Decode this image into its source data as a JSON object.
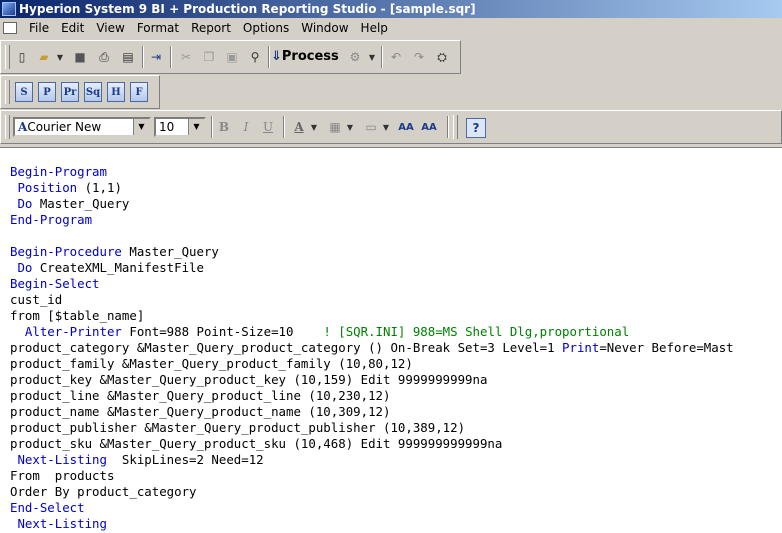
{
  "window": {
    "title": "Hyperion System 9 BI + Production Reporting Studio - [sample.sqr]"
  },
  "menu": [
    "File",
    "Edit",
    "View",
    "Format",
    "Report",
    "Options",
    "Window",
    "Help"
  ],
  "toolbar_main": {
    "icons": [
      "new-file-icon",
      "open-folder-icon",
      "dropdown-arrow-icon",
      "save-icon",
      "print-icon",
      "print-preview-icon",
      "export-icon",
      "cut-icon",
      "copy-icon",
      "paste-icon",
      "find-icon"
    ],
    "process_label": "Process"
  },
  "toolbar_sections": [
    "S",
    "P",
    "Pr",
    "Sq",
    "H",
    "F"
  ],
  "format": {
    "font": "Courier New",
    "size": "10"
  },
  "code": {
    "l1": "Begin-Program",
    "l2_kw": " Position",
    "l2_rest": " (1,1)",
    "l3_kw": " Do",
    "l3_rest": " Master_Query",
    "l4": "End-Program",
    "l6_kw": "Begin-Procedure",
    "l6_rest": " Master_Query",
    "l7_kw": " Do",
    "l7_rest": " CreateXML_ManifestFile",
    "l8": "Begin-Select",
    "l9": "cust_id",
    "l10": "from [$table_name]",
    "l11_kw": "  Alter-Printer",
    "l11_rest": " Font=988 Point-Size=10    ",
    "l11_cmt": "! [SQR.INI] 988=MS Shell Dlg,proportional",
    "l12_pre": "product_category &Master_Query_product_category () On-Break Set=3 Level=1 ",
    "l12_kw": "Print",
    "l12_post": "=Never Before=Mast",
    "l13": "product_family &Master_Query_product_family (10,80,12)",
    "l14": "product_key &Master_Query_product_key (10,159) Edit 9999999999na",
    "l15": "product_line &Master_Query_product_line (10,230,12)",
    "l16": "product_name &Master_Query_product_name (10,309,12)",
    "l17": "product_publisher &Master_Query_product_publisher (10,389,12)",
    "l18": "product_sku &Master_Query_product_sku (10,468) Edit 999999999999na",
    "l19_kw": " Next-Listing",
    "l19_rest": "  SkipLines=2 Need=12",
    "l20": "From  products",
    "l21": "Order By product_category",
    "l22": "End-Select",
    "l23": " Next-Listing"
  }
}
